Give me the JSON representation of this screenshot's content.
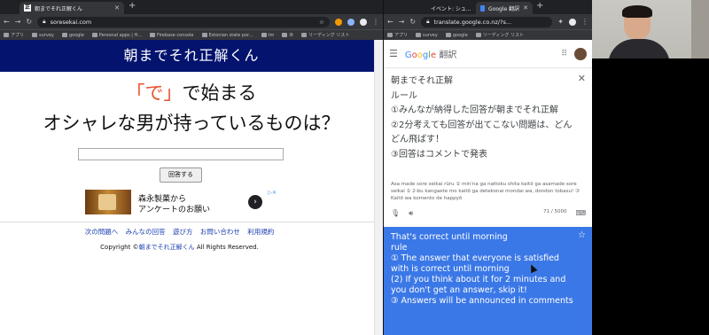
{
  "left_browser": {
    "tab_title": "朝までそれ正解くん",
    "url": "soresekai.com",
    "bookmarks": [
      "アプリ",
      "survey",
      "google",
      "Personal apps | H...",
      "Firebase console",
      "Estonian state por...",
      "tm",
      "llt",
      "リーディング リスト"
    ],
    "page": {
      "header": "朝までそれ正解くん",
      "question_line1_quoted": "「で」",
      "question_line1_rest": "で始まる",
      "question_line2": "オシャレな男が持っているものは？",
      "answer_value": "",
      "submit_label": "回答する",
      "ad_line1": "森永製菓から",
      "ad_line2": "アンケートのお願い",
      "ad_arrow": "›",
      "ad_choices": "▷✕",
      "footer_links": [
        "次の問題へ",
        "みんなの回答",
        "遊び方",
        "お問い合わせ",
        "利用規約"
      ],
      "copyright_prefix": "Copyright ©",
      "copyright_brand": "朝までそれ正解くん",
      "copyright_suffix": "All Rights Reserved."
    }
  },
  "right_browser": {
    "tabs": [
      "イベント: シュ...",
      "Google 翻訳"
    ],
    "url": "translate.google.co.nz/?s...",
    "bookmarks": [
      "アプリ",
      "survey",
      "google",
      "リーディング リスト"
    ],
    "app_name": "Google 翻訳",
    "source_text": "朝までそれ正解\nルール\n①みんなが納得した回答が朝までそれ正解\n②2分考えても回答が出てこない問題は、どんどん飛ばす！\n③回答はコメントで発表",
    "romanization": "Asa made sore seikai rūru ① min'na ga nattoku shita kaitō ga asamade sore seikai ② 2-bu kangaete mo kaitō ga detekonai mondai wa, dondon tobasu! ③ Kaitō wa komento de happyō",
    "char_count": "71 / 5000",
    "translation": "That's correct until morning\nrule\n① The answer that everyone is satisfied with is correct until morning\n(2) If you think about it for 2 minutes and you don't get an answer, skip it!\n③ Answers will be announced in comments"
  },
  "colors": {
    "site_header": "#03136e",
    "quote_red": "#e8502e",
    "translate_blue": "#3b78e7",
    "link_blue": "#1a3fb0"
  }
}
